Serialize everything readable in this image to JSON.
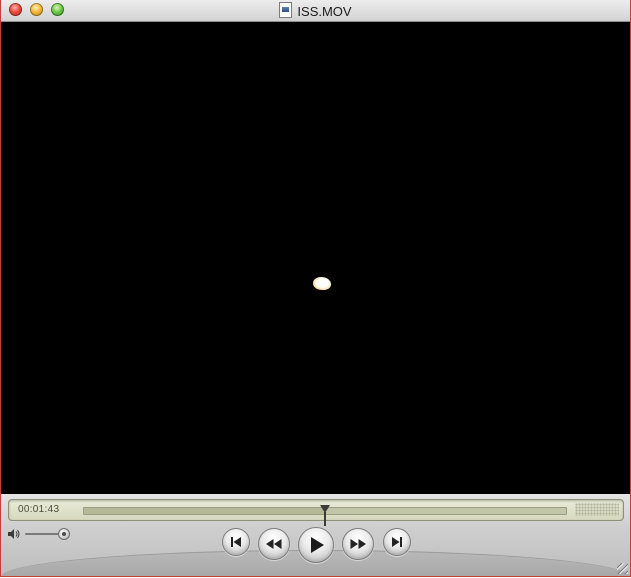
{
  "window": {
    "title": "ISS.MOV",
    "title_icon": "movie-document-icon"
  },
  "video": {
    "background": "#000000"
  },
  "controls": {
    "current_time": "00:01:43",
    "playback_position": 0.5,
    "volume_level": 0.95,
    "buttons": {
      "go_to_start_icon": "skip-to-start-icon",
      "rewind_icon": "rewind-icon",
      "play_icon": "play-icon",
      "fast_forward_icon": "fast-forward-icon",
      "go_to_end_icon": "skip-to-end-icon"
    }
  },
  "colors": {
    "lcd_background": "#dfe2c9",
    "close": "#e8493c",
    "minimize": "#f2b538",
    "zoom": "#6cc448"
  }
}
